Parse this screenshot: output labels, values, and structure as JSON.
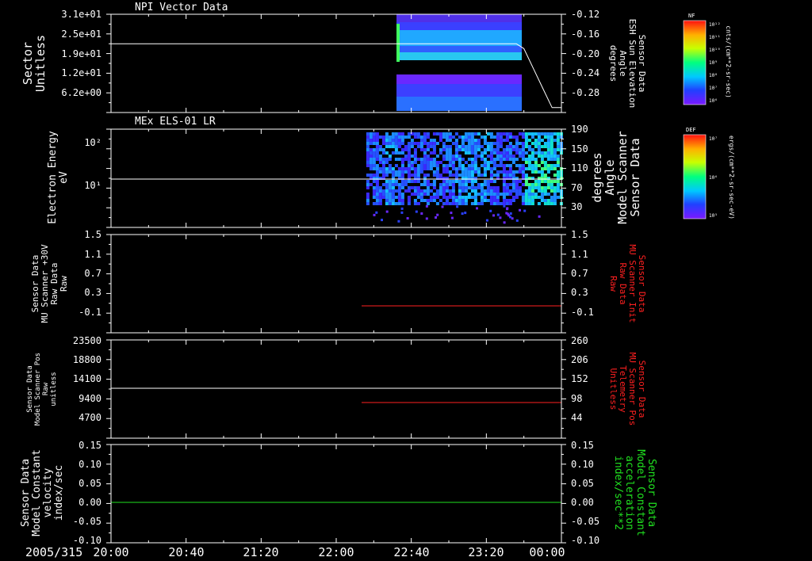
{
  "date_label": "2005/315",
  "x_ticks": [
    "20:00",
    "20:40",
    "21:20",
    "22:00",
    "22:40",
    "23:20",
    "00:00"
  ],
  "colors": {
    "fg": "#ffffff",
    "red": "#ff2020",
    "green": "#20e020",
    "bg": "#000000"
  },
  "chart_data": [
    {
      "type": "heatmap",
      "title": "NPI Vector Data",
      "left_axis_label": [
        "Sector",
        "Unitless"
      ],
      "left_ticks": [
        "3.1e+01",
        "2.5e+01",
        "1.9e+01",
        "1.2e+01",
        "6.2e+00"
      ],
      "right_axis_label": [
        "Sensor Data",
        "ESH Sun Elevation",
        "Angle",
        "degrees"
      ],
      "right_ticks": [
        "-0.12",
        "-0.16",
        "-0.20",
        "-0.24",
        "-0.28"
      ],
      "colorbar": {
        "name": "NF",
        "units": "cnts/(cm**2-sr-sec)",
        "ticks": [
          "10¹²",
          "10¹¹",
          "10¹⁰",
          "10⁹",
          "10⁸",
          "10⁷",
          "10⁶"
        ]
      },
      "data_coverage": {
        "start": "22:24",
        "end": "23:36"
      },
      "line_series": {
        "name": "ESH Sun Elevation Angle",
        "color": "white",
        "x": [
          "20:00",
          "23:36",
          "23:40",
          "23:45",
          "23:50",
          "23:55",
          "00:00"
        ],
        "y": [
          -0.16,
          -0.16,
          -0.17,
          -0.21,
          -0.25,
          -0.29,
          -0.29
        ]
      }
    },
    {
      "type": "heatmap",
      "title": "MEx ELS-01 LR",
      "left_axis_label": [
        "Electron Energy",
        "eV"
      ],
      "left_ticks": [
        "10²",
        "10¹"
      ],
      "right_axis_label": [
        "Sensor Data",
        "Model Scanner",
        "Angle",
        "degrees"
      ],
      "right_ticks": [
        "190",
        "150",
        "110",
        "70",
        "30"
      ],
      "colorbar": {
        "name": "DEF",
        "units": "ergs/(cm**2-sr-sec-eV)",
        "ticks": [
          "10⁷",
          "10⁶",
          "10⁵"
        ]
      },
      "data_coverage": {
        "start": "22:16",
        "end": "00:00"
      },
      "line_series": {
        "name": "Model Scanner Angle",
        "color": "white",
        "x": [
          "20:00",
          "00:00"
        ],
        "y": [
          90,
          90
        ]
      }
    },
    {
      "type": "line",
      "left_axis_label": [
        "Sensor Data",
        "MU Scanner +30V",
        "Raw Data",
        "Raw"
      ],
      "left_ticks": [
        "1.5",
        "1.1",
        "0.7",
        "0.3",
        "-0.1"
      ],
      "right_axis_label": [
        "Sensor Data",
        "MU Scanner Init",
        "Raw Data",
        "Raw"
      ],
      "right_ticks": [
        "1.5",
        "1.1",
        "0.7",
        "0.3",
        "-0.1"
      ],
      "series": [
        {
          "name": "MU Scanner Init",
          "axis": "right",
          "color": "red",
          "x": [
            "22:08",
            "00:00"
          ],
          "y": [
            0.0,
            0.0
          ]
        }
      ]
    },
    {
      "type": "line",
      "left_axis_label": [
        "Sensor Data",
        "Model Scanner Pos",
        "Raw",
        "unitless"
      ],
      "left_ticks": [
        "23500",
        "18800",
        "14100",
        "9400",
        "4700"
      ],
      "right_axis_label": [
        "Sensor Data",
        "MU Scanner Pos",
        "Telemetry",
        "Unitless"
      ],
      "right_ticks": [
        "260",
        "206",
        "152",
        "98",
        "44"
      ],
      "series": [
        {
          "name": "Model Scanner Pos",
          "axis": "left",
          "color": "white",
          "x": [
            "20:00",
            "00:00"
          ],
          "y": [
            12100,
            12100
          ]
        },
        {
          "name": "MU Scanner Pos",
          "axis": "right",
          "color": "red",
          "x": [
            "22:08",
            "00:00"
          ],
          "y": [
            97,
            97
          ]
        }
      ]
    },
    {
      "type": "line",
      "left_axis_label": [
        "Sensor Data",
        "Model Constant",
        "velocity",
        "index/sec"
      ],
      "left_ticks": [
        "0.15",
        "0.10",
        "0.05",
        "0.00",
        "-0.05",
        "-0.10"
      ],
      "right_axis_label": [
        "Sensor Data",
        "Model Constant",
        "acceleration",
        "index/sec**2"
      ],
      "right_ticks": [
        "0.15",
        "0.10",
        "0.05",
        "0.00",
        "-0.05",
        "-0.10"
      ],
      "series": [
        {
          "name": "Model Constant acceleration",
          "axis": "right",
          "color": "green",
          "x": [
            "20:00",
            "00:00"
          ],
          "y": [
            0.0,
            0.0
          ]
        }
      ]
    }
  ]
}
